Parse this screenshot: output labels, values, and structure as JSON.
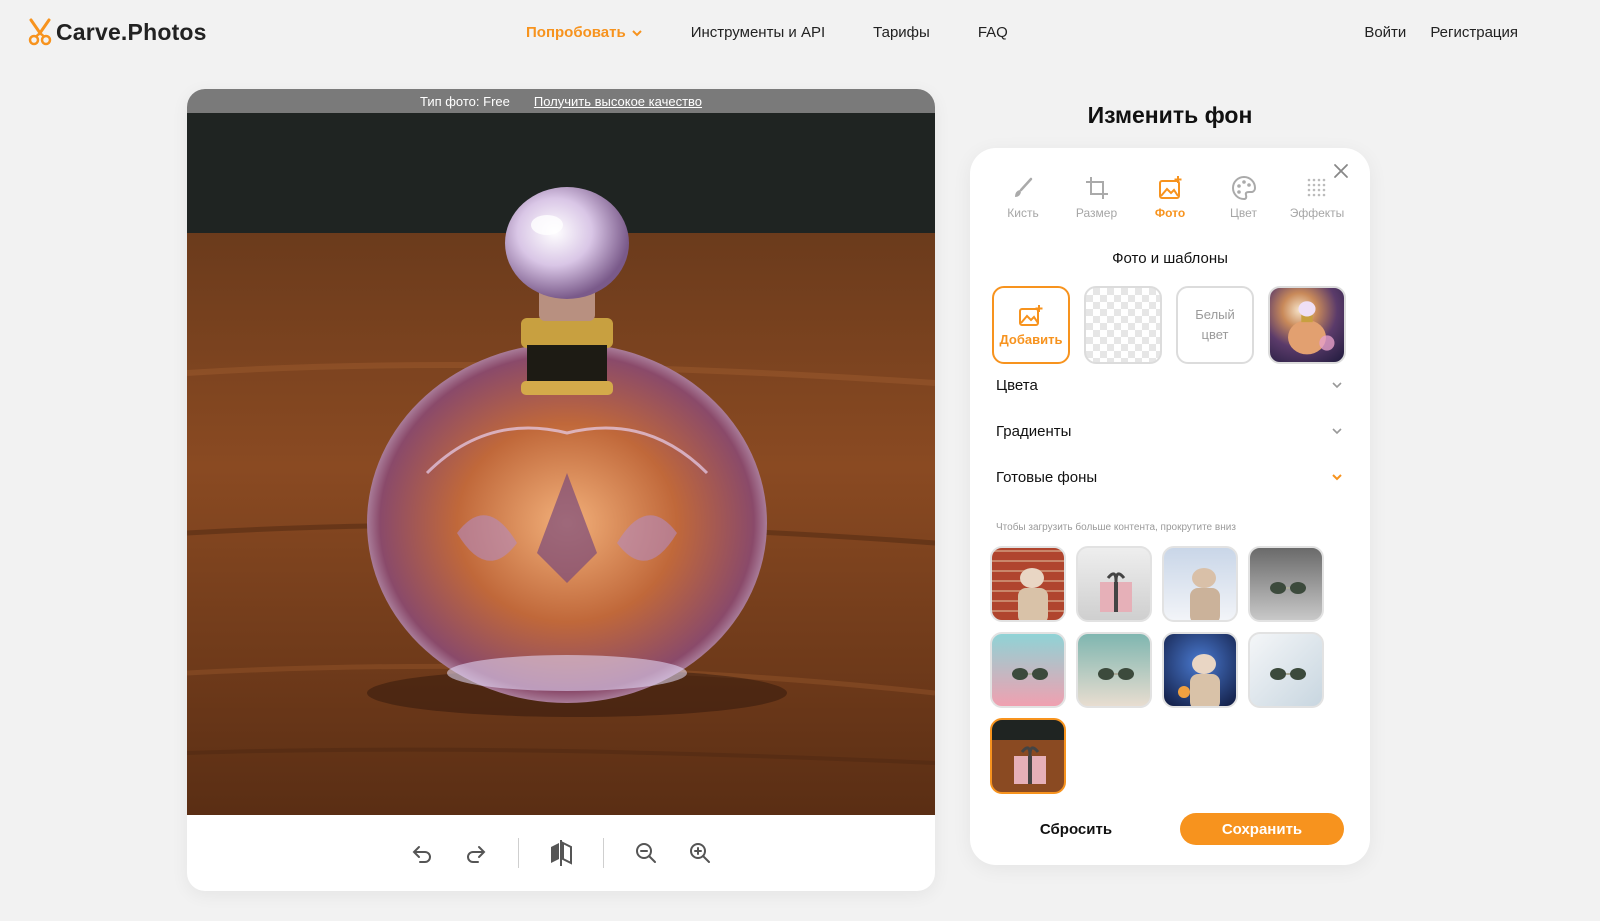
{
  "header": {
    "logo_text": "Carve.Photos",
    "nav": [
      {
        "label": "Попробовать",
        "active": true
      },
      {
        "label": "Инструменты и API"
      },
      {
        "label": "Тарифы"
      },
      {
        "label": "FAQ"
      }
    ],
    "login": "Войти",
    "register": "Регистрация"
  },
  "editor": {
    "photo_type": "Тип фото: Free",
    "hq_link": "Получить высокое качество",
    "toolbar_icons": [
      "undo-icon",
      "redo-icon",
      "compare-icon",
      "zoom-out-icon",
      "zoom-in-icon"
    ]
  },
  "panel": {
    "title": "Изменить фон",
    "tabs": [
      {
        "label": "Кисть",
        "icon": "brush-icon"
      },
      {
        "label": "Размер",
        "icon": "crop-icon"
      },
      {
        "label": "Фото",
        "icon": "photo-icon",
        "active": true
      },
      {
        "label": "Цвет",
        "icon": "palette-icon"
      },
      {
        "label": "Эффекты",
        "icon": "effects-icon"
      }
    ],
    "section_title": "Фото и шаблоны",
    "templates": {
      "add_label": "Добавить",
      "white_label_1": "Белый",
      "white_label_2": "цвет"
    },
    "accordions": [
      "Цвета",
      "Градиенты",
      "Готовые фоны"
    ],
    "hint": "Чтобы загрузить больше контента, прокрутите вниз",
    "reset": "Сбросить",
    "save": "Сохранить"
  },
  "colors": {
    "accent": "#f7931e",
    "background": "#f2f2f2"
  }
}
